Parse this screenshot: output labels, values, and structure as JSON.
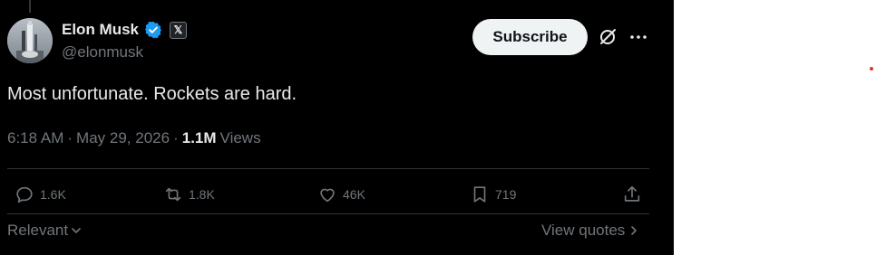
{
  "author": {
    "name": "Elon Musk",
    "handle": "@elonmusk",
    "avatar_icon": "rocket-launch-photo",
    "verified_icon": "verified-badge-icon",
    "affiliation_badge": "𝕏"
  },
  "header": {
    "subscribe_label": "Subscribe"
  },
  "post": {
    "text": "Most unfortunate. Rockets are hard.",
    "time": "6:18 AM",
    "date": "May 29, 2026",
    "views_count": "1.1M",
    "views_label": "Views"
  },
  "actions": {
    "replies": "1.6K",
    "reposts": "1.8K",
    "likes": "46K",
    "bookmarks": "719"
  },
  "footer": {
    "sort_label": "Relevant",
    "quotes_label": "View quotes"
  },
  "colors": {
    "background": "#000000",
    "text": "#e7e9ea",
    "muted": "#71767b",
    "verified": "#1d9bf0"
  }
}
